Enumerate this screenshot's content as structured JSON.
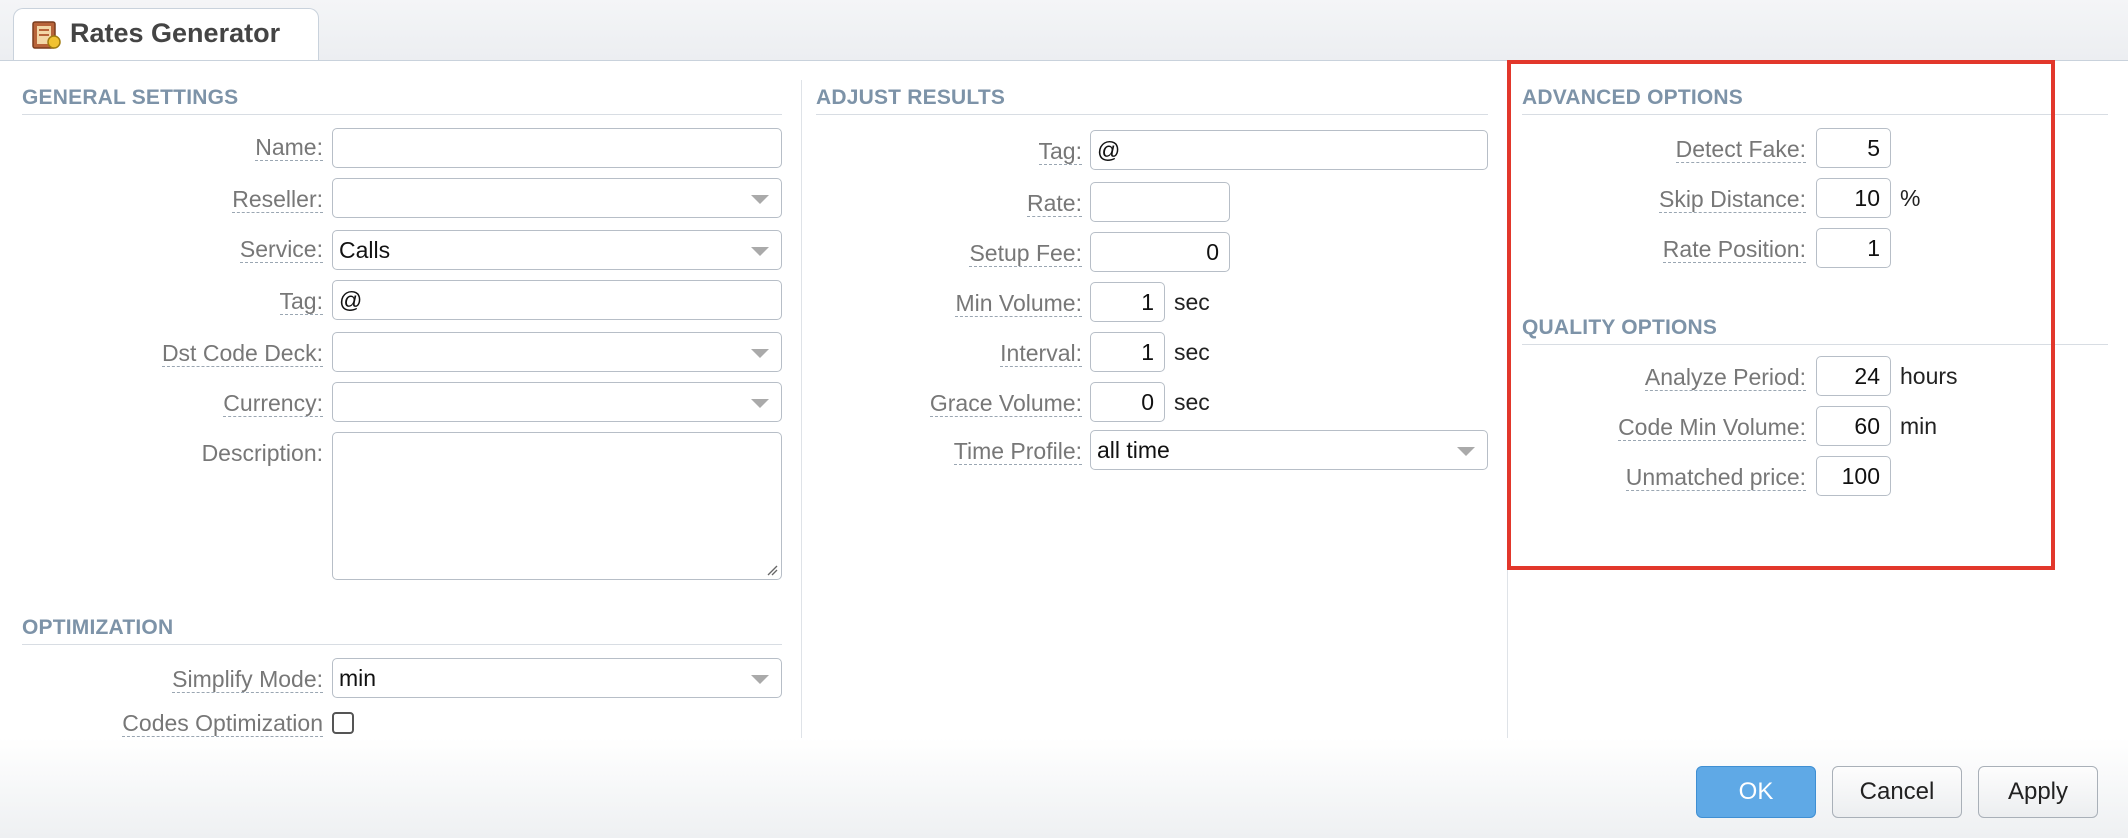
{
  "window": {
    "title": "Rates Generator",
    "icon": "rates-generator-icon"
  },
  "general": {
    "title": "GENERAL SETTINGS",
    "name_label": "Name:",
    "name_value": "",
    "reseller_label": "Reseller:",
    "reseller_value": "",
    "service_label": "Service:",
    "service_value": "Calls",
    "tag_label": "Tag:",
    "tag_value": "@",
    "dst_label": "Dst Code Deck:",
    "dst_value": "",
    "currency_label": "Currency:",
    "currency_value": "",
    "description_label": "Description:",
    "description_value": ""
  },
  "optimization": {
    "title": "OPTIMIZATION",
    "simplify_label": "Simplify Mode:",
    "simplify_value": "min",
    "codes_label": "Codes Optimization",
    "codes_checked": false
  },
  "adjust": {
    "title": "ADJUST RESULTS",
    "tag_label": "Tag:",
    "tag_value": "@",
    "rate_label": "Rate:",
    "rate_value": "",
    "setup_label": "Setup Fee:",
    "setup_value": "0",
    "minvol_label": "Min Volume:",
    "minvol_value": "1",
    "minvol_unit": "sec",
    "interval_label": "Interval:",
    "interval_value": "1",
    "interval_unit": "sec",
    "grace_label": "Grace Volume:",
    "grace_value": "0",
    "grace_unit": "sec",
    "profile_label": "Time Profile:",
    "profile_value": "all time"
  },
  "advanced": {
    "title": "ADVANCED OPTIONS",
    "fake_label": "Detect Fake:",
    "fake_value": "5",
    "skip_label": "Skip Distance:",
    "skip_value": "10",
    "skip_unit": "%",
    "position_label": "Rate Position:",
    "position_value": "1"
  },
  "quality": {
    "title": "QUALITY OPTIONS",
    "period_label": "Analyze Period:",
    "period_value": "24",
    "period_unit": "hours",
    "codemin_label": "Code Min Volume:",
    "codemin_value": "60",
    "codemin_unit": "min",
    "unmatched_label": "Unmatched price:",
    "unmatched_value": "100"
  },
  "buttons": {
    "ok": "OK",
    "cancel": "Cancel",
    "apply": "Apply"
  },
  "colors": {
    "highlight": "#e2372b",
    "primary_button": "#5fa9e6",
    "section_title": "#7d93a8"
  }
}
